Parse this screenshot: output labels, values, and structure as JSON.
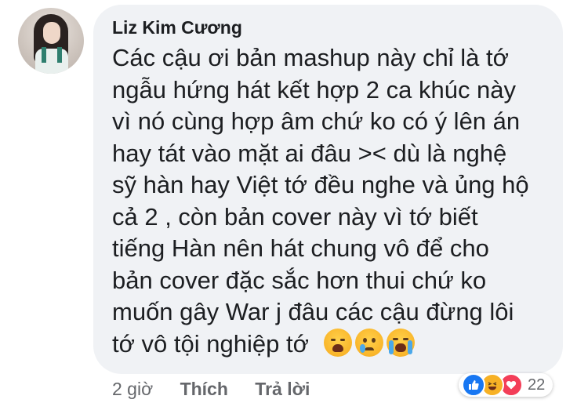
{
  "comment": {
    "author": "Liz Kim Cương",
    "lines": [
      "Các cậu ơi bản mashup này chỉ là tớ",
      "ngẫu hứng hát kết hợp 2 ca khúc này",
      "vì nó cùng hợp âm chứ ko có ý lên án",
      "hay tát vào mặt ai đâu >< dù là nghệ",
      "sỹ hàn hay Việt tớ đều nghe và ủng hộ",
      "cả 2 , còn bản cover này vì tớ biết",
      "tiếng Hàn nên hát chung vô để cho",
      "bản cover đặc sắc hơn thui chứ ko",
      "muốn gây War j đâu các cậu đừng lôi",
      "tớ vô tội nghiệp tớ"
    ],
    "emojis": [
      "weary-face-icon",
      "crying-face-icon",
      "loudly-crying-face-icon"
    ]
  },
  "actions": {
    "time": "2 giờ",
    "like": "Thích",
    "reply": "Trả lời"
  },
  "reactions": {
    "icons": [
      "like-icon",
      "haha-icon",
      "love-icon"
    ],
    "count": "22"
  },
  "colors": {
    "bubble": "#f0f2f5",
    "text": "#1c1e21",
    "secondary": "#65676b",
    "like": "#1877f2",
    "love": "#f33e58",
    "haha": "#f7b125"
  }
}
